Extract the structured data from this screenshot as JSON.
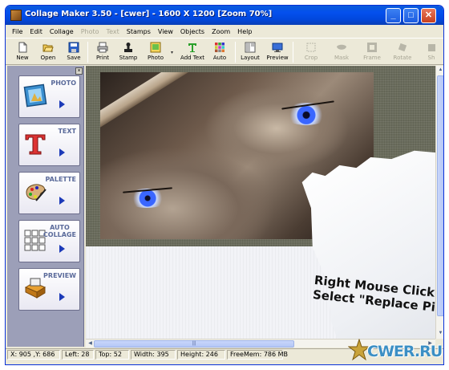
{
  "window": {
    "title": "Collage Maker 3.50 - [cwer] - 1600 X 1200  [Zoom 70%]"
  },
  "menu": [
    {
      "label": "File",
      "enabled": true
    },
    {
      "label": "Edit",
      "enabled": true
    },
    {
      "label": "Collage",
      "enabled": true
    },
    {
      "label": "Photo",
      "enabled": false
    },
    {
      "label": "Text",
      "enabled": false
    },
    {
      "label": "Stamps",
      "enabled": true
    },
    {
      "label": "View",
      "enabled": true
    },
    {
      "label": "Objects",
      "enabled": true
    },
    {
      "label": "Zoom",
      "enabled": true
    },
    {
      "label": "Help",
      "enabled": true
    }
  ],
  "toolbar": {
    "new": "New",
    "open": "Open",
    "save": "Save",
    "print": "Print",
    "stamp": "Stamp",
    "photo": "Photo",
    "add_text": "Add Text",
    "auto": "Auto",
    "layout": "Layout",
    "preview": "Preview",
    "crop": "Crop",
    "mask": "Mask",
    "frame": "Frame",
    "rotate": "Rotate",
    "sh": "Sh"
  },
  "left_panel": {
    "photo": "PHOTO",
    "text": "TEXT",
    "palette": "PALETTE",
    "auto_collage_1": "AUTO",
    "auto_collage_2": "COLLAGE",
    "preview": "PREVIEW"
  },
  "canvas": {
    "note_line1": "Right Mouse Click",
    "note_line2": "Select \"Replace Pi"
  },
  "status": {
    "coords": "X: 905 ,Y: 686",
    "left": "Left: 28",
    "top": "Top: 52",
    "width": "Width: 395",
    "height": "Height: 246",
    "freemem": "FreeMem: 786 MB"
  },
  "watermark": "CWER.RU",
  "colors": {
    "titlebar": "#0450ee",
    "panel": "#9c9fb8",
    "accent": "#1c3ab8"
  }
}
